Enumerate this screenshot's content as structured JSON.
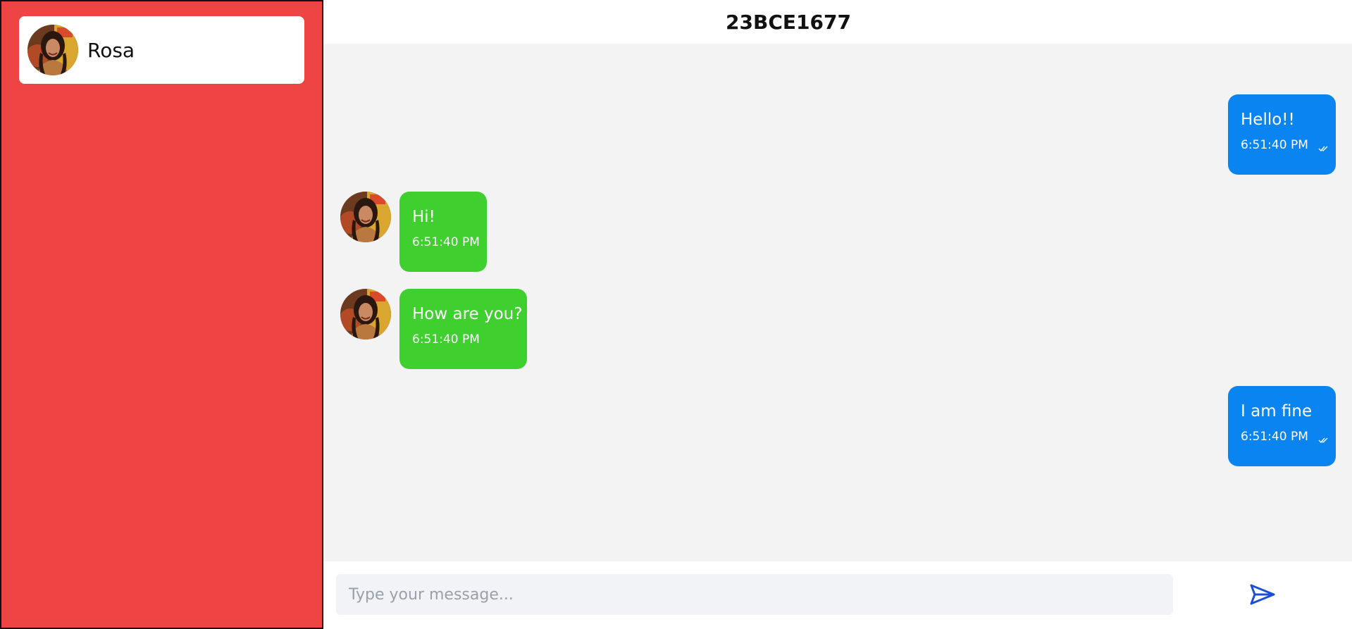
{
  "sidebar": {
    "contacts": [
      {
        "name": "Rosa",
        "avatar_icon": "avatar-portrait"
      }
    ]
  },
  "chat": {
    "title": "23BCE1677",
    "messages": [
      {
        "direction": "sent",
        "text": "Hello!!",
        "time": "6:51:40 PM",
        "status_icon": "double-check-icon"
      },
      {
        "direction": "received",
        "text": "Hi!",
        "time": "6:51:40 PM"
      },
      {
        "direction": "received",
        "text": "How are you?",
        "time": "6:51:40 PM"
      },
      {
        "direction": "sent",
        "text": "I am fine",
        "time": "6:51:40 PM",
        "status_icon": "double-check-icon"
      }
    ]
  },
  "composer": {
    "placeholder": "Type your message...",
    "value": "",
    "send_icon": "send-icon"
  },
  "colors": {
    "sidebar_bg": "#ef4444",
    "sent_bubble": "#0a84f0",
    "received_bubble": "#3fcf2e",
    "chat_bg": "#f3f3f3",
    "send_icon": "#1d4ed8"
  }
}
